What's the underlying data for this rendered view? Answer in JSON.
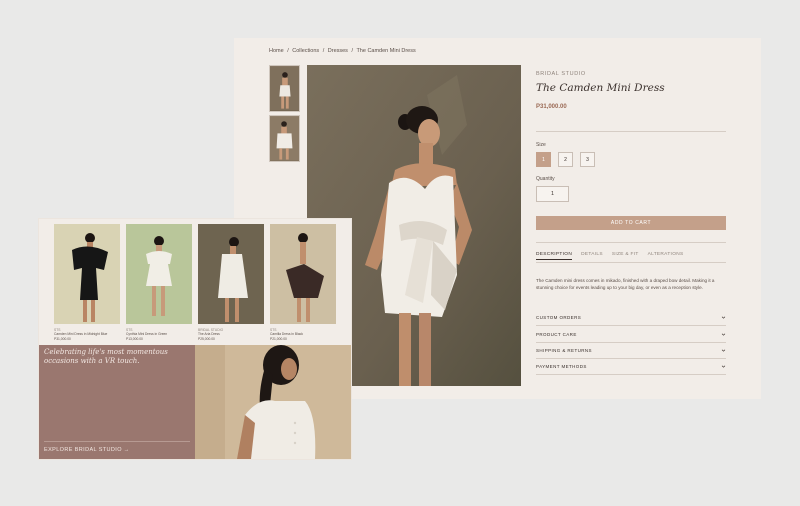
{
  "breadcrumb": [
    "Home",
    "/",
    "Collections",
    "/",
    "Dresses",
    "/",
    "The Camden Mini Dress"
  ],
  "product": {
    "brand": "BRIDAL STUDIO",
    "title": "The Camden Mini Dress",
    "price": "P31,000.00",
    "size_label": "Size",
    "sizes": [
      {
        "label": "1",
        "selected": true
      },
      {
        "label": "2",
        "selected": false
      },
      {
        "label": "3",
        "selected": false
      }
    ],
    "quantity_label": "Quantity",
    "quantity_value": "1",
    "add_to_cart": "ADD TO CART",
    "tabs": [
      "DESCRIPTION",
      "DETAILS",
      "SIZE & FIT",
      "ALTERATIONS"
    ],
    "description": "The Camden mini dress comes in mikado, finished with a draped bow detail. Making it a stunning choice for events leading up to your big day, or even as a reception style.",
    "accordions": [
      "CUSTOM ORDERS",
      "PRODUCT CARE",
      "SHIPPING & RETURNS",
      "PAYMENT METHODS"
    ]
  },
  "collection": {
    "items": [
      {
        "brand": "STS",
        "name": "Camden Mini Dress in Midnight Blue",
        "price": "P31,000.00"
      },
      {
        "brand": "STS",
        "name": "Cynthia Mini Dress in Green",
        "price": "P13,000.00"
      },
      {
        "brand": "BRIDAL STUDIO",
        "name": "The Aria Dress",
        "price": "P25,000.00"
      },
      {
        "brand": "STS",
        "name": "Camilla Dress in Black",
        "price": "P21,000.00"
      }
    ],
    "promo_heading": "Celebrating life's most momentous occasions with a VR touch.",
    "promo_link": "EXPLORE BRIDAL STUDIO →"
  },
  "colors": {
    "accent": "#c4a08a",
    "price": "#9b6a55",
    "promo_panel": "#9a776f",
    "page_bg": "#f2ede8"
  }
}
